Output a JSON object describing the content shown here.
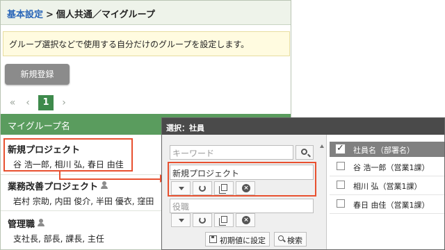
{
  "breadcrumb": {
    "parent": "基本設定",
    "separator": ">",
    "current": "個人共通／マイグループ"
  },
  "notice": "グループ選択などで使用する自分だけのグループを設定します。",
  "toolbar": {
    "new_label": "新規登録"
  },
  "pager": {
    "first": "«",
    "prev": "‹",
    "current_page": "1",
    "next": "›"
  },
  "group_list": {
    "header": "マイグループ名",
    "rows": [
      {
        "name": "新規プロジェクト",
        "members": "谷 浩一郎, 相川 弘, 春日 由佳"
      },
      {
        "name": "業務改善プロジェクト",
        "members": "岩村 宗助, 内田 俊介, 半田 優衣, 窪田"
      },
      {
        "name": "管理職",
        "members": "支社長, 部長, 課長, 主任"
      }
    ]
  },
  "dialog": {
    "title": "選択：社員",
    "keyword_placeholder": "キーワード",
    "group_value": "新規プロジェクト",
    "role_placeholder": "役職",
    "reset_label": "初期値に設定",
    "search_label": "検索",
    "result_header": "社員名（部署名）",
    "results": [
      "谷 浩一郎（営業1課）",
      "相川 弘（営業1課）",
      "春日 由佳（営業1課）"
    ]
  },
  "colors": {
    "accent": "#5a9c5e",
    "highlight": "#e8502f",
    "link": "#2a66b8"
  }
}
